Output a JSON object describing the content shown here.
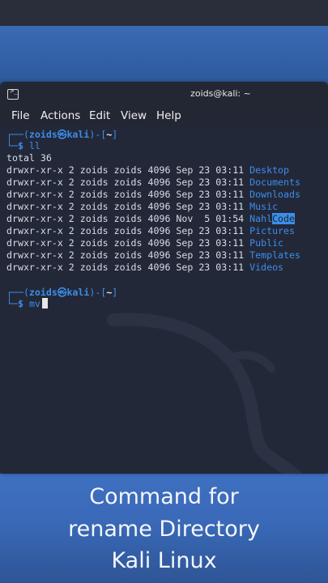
{
  "window": {
    "title": "zoids@kali: ~"
  },
  "menu": [
    "File",
    "Actions",
    "Edit",
    "View",
    "Help"
  ],
  "terminal": {
    "prompt1_top": "┌──(",
    "user": "zoids",
    "at": "㉿",
    "host": "kali",
    "prompt_mid": ")-[",
    "path": "~",
    "prompt_end": "]",
    "prompt_bottom": "└─",
    "dollar": "$",
    "cmd1": "ll",
    "total": "total 36",
    "entries": [
      {
        "perm": "drwxr-xr-x 2 zoids zoids 4096 Sep 23 03:11",
        "name": "Desktop"
      },
      {
        "perm": "drwxr-xr-x 2 zoids zoids 4096 Sep 23 03:11",
        "name": "Documents"
      },
      {
        "perm": "drwxr-xr-x 2 zoids zoids 4096 Sep 23 03:11",
        "name": "Downloads"
      },
      {
        "perm": "drwxr-xr-x 2 zoids zoids 4096 Sep 23 03:11",
        "name": "Music"
      },
      {
        "perm": "drwxr-xr-x 2 zoids zoids 4096 Nov  5 01:54",
        "name_a": "Nahl",
        "name_b": "Code"
      },
      {
        "perm": "drwxr-xr-x 2 zoids zoids 4096 Sep 23 03:11",
        "name": "Pictures"
      },
      {
        "perm": "drwxr-xr-x 2 zoids zoids 4096 Sep 23 03:11",
        "name": "Public"
      },
      {
        "perm": "drwxr-xr-x 2 zoids zoids 4096 Sep 23 03:11",
        "name": "Templates"
      },
      {
        "perm": "drwxr-xr-x 2 zoids zoids 4096 Sep 23 03:11",
        "name": "Videos"
      }
    ],
    "cmd2": "mv"
  },
  "caption": [
    "Command for",
    "rename Directory",
    "Kali Linux"
  ],
  "colors": {
    "accent": "#3b8eea",
    "terminal_bg": "#232838",
    "desktop": "#2d5a9c"
  }
}
